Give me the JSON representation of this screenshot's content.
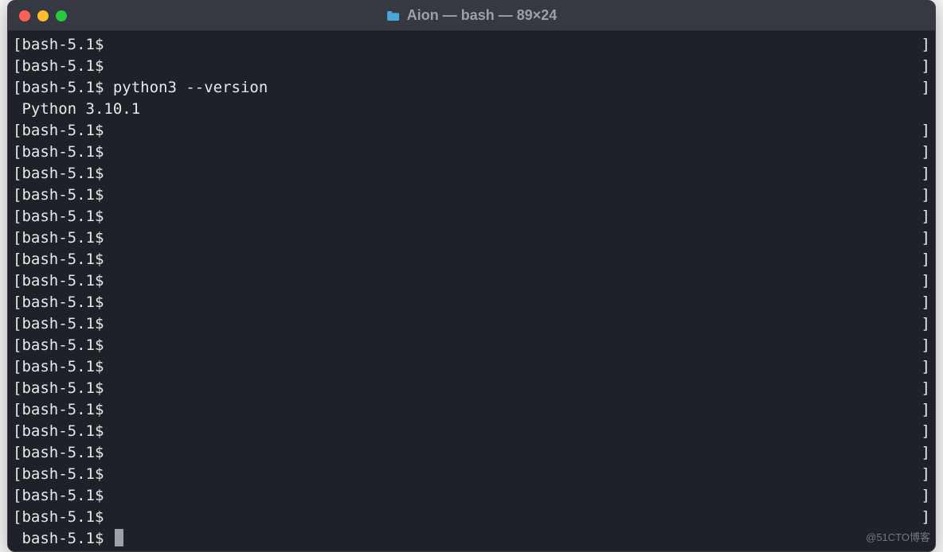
{
  "window": {
    "title": "Aion — bash — 89×24"
  },
  "terminal": {
    "prompt": "bash-5.1$",
    "lines": [
      {
        "type": "prompt",
        "left": "[bash-5.1$ ",
        "right": "]"
      },
      {
        "type": "prompt",
        "left": "[bash-5.1$ ",
        "right": "]"
      },
      {
        "type": "command",
        "left": "[bash-5.1$ python3 --version",
        "right": "]"
      },
      {
        "type": "output",
        "left": " Python 3.10.1",
        "right": ""
      },
      {
        "type": "prompt",
        "left": "[bash-5.1$ ",
        "right": "]"
      },
      {
        "type": "prompt",
        "left": "[bash-5.1$ ",
        "right": "]"
      },
      {
        "type": "prompt",
        "left": "[bash-5.1$ ",
        "right": "]"
      },
      {
        "type": "prompt",
        "left": "[bash-5.1$ ",
        "right": "]"
      },
      {
        "type": "prompt",
        "left": "[bash-5.1$ ",
        "right": "]"
      },
      {
        "type": "prompt",
        "left": "[bash-5.1$ ",
        "right": "]"
      },
      {
        "type": "prompt",
        "left": "[bash-5.1$ ",
        "right": "]"
      },
      {
        "type": "prompt",
        "left": "[bash-5.1$ ",
        "right": "]"
      },
      {
        "type": "prompt",
        "left": "[bash-5.1$ ",
        "right": "]"
      },
      {
        "type": "prompt",
        "left": "[bash-5.1$ ",
        "right": "]"
      },
      {
        "type": "prompt",
        "left": "[bash-5.1$ ",
        "right": "]"
      },
      {
        "type": "prompt",
        "left": "[bash-5.1$ ",
        "right": "]"
      },
      {
        "type": "prompt",
        "left": "[bash-5.1$ ",
        "right": "]"
      },
      {
        "type": "prompt",
        "left": "[bash-5.1$ ",
        "right": "]"
      },
      {
        "type": "prompt",
        "left": "[bash-5.1$ ",
        "right": "]"
      },
      {
        "type": "prompt",
        "left": "[bash-5.1$ ",
        "right": "]"
      },
      {
        "type": "prompt",
        "left": "[bash-5.1$ ",
        "right": "]"
      },
      {
        "type": "prompt",
        "left": "[bash-5.1$ ",
        "right": "]"
      },
      {
        "type": "prompt",
        "left": "[bash-5.1$ ",
        "right": "]"
      },
      {
        "type": "cursor",
        "left": " bash-5.1$ ",
        "right": ""
      }
    ]
  },
  "watermark": "@51CTO博客"
}
